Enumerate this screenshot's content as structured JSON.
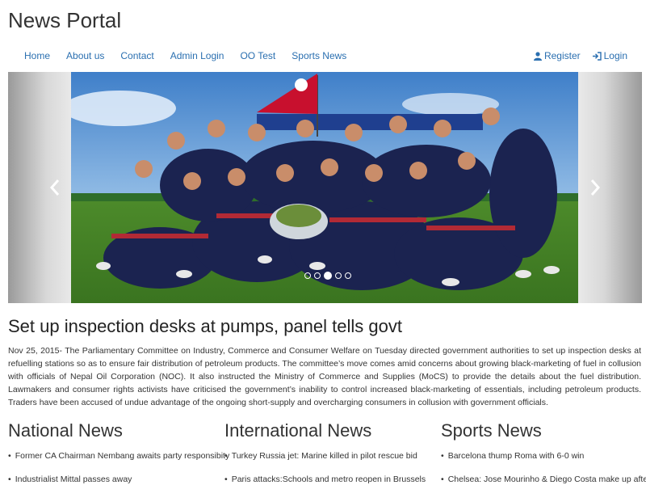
{
  "site": {
    "title": "News Portal"
  },
  "nav": {
    "left": [
      "Home",
      "About us",
      "Contact",
      "Admin Login",
      "OO Test",
      "Sports News"
    ],
    "register": "Register",
    "login": "Login"
  },
  "carousel": {
    "slides": 5,
    "active_index": 2
  },
  "featured": {
    "headline": "Set up inspection desks at pumps, panel tells govt",
    "body": "Nov 25, 2015- The Parliamentary Committee on Industry, Commerce and Consumer Welfare on Tuesday directed government authorities to set up inspection desks at refuelling stations so as to ensure fair distribution of petroleum products. The committee’s move comes amid concerns about growing black-marketing of fuel in collusion with officials of Nepal Oil Corporation (NOC). It also instructed the Ministry of Commerce and Supplies (MoCS) to provide the details about the fuel distribution. Lawmakers and consumer rights activists have criticised the government’s inability to control increased black-marketing of essentials, including petroleum products. Traders have been accused of undue advantage of the ongoing short-supply and overcharging consumers in collusion with government officials."
  },
  "sections": [
    {
      "title": "National News",
      "items": [
        "Former CA Chairman Nembang awaits party responsibity",
        "Industrialist Mittal passes away"
      ]
    },
    {
      "title": "International News",
      "items": [
        "Turkey Russia jet: Marine killed in pilot rescue bid",
        "Paris attacks:Schools and metro reopen in Brussels"
      ]
    },
    {
      "title": "Sports News",
      "items": [
        "Barcelona thump Roma with 6-0 win",
        "Chelsea: Jose Mourinho & Diego Costa make up after"
      ]
    }
  ]
}
